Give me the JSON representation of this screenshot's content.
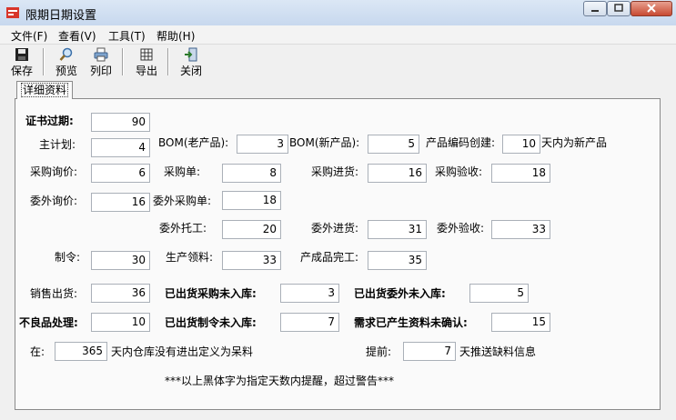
{
  "window": {
    "title": "限期日期设置"
  },
  "menu": [
    "文件(F)",
    "查看(V)",
    "工具(T)",
    "帮助(H)"
  ],
  "toolbar": [
    "保存",
    "预览",
    "列印",
    "导出",
    "关闭"
  ],
  "tab": "详细资料",
  "fields": {
    "cert_expiry": {
      "label": "证书过期:",
      "value": "90"
    },
    "main_plan": {
      "label": "主计划:",
      "value": "4"
    },
    "bom_old": {
      "label": "BOM(老产品):",
      "value": "3"
    },
    "bom_new": {
      "label": "BOM(新产品):",
      "value": "5"
    },
    "code_create": {
      "label": "产品编码创建:",
      "value": "10",
      "suffix": "天内为新产品"
    },
    "purchase_inq": {
      "label": "采购询价:",
      "value": "6"
    },
    "purchase_order": {
      "label": "采购单:",
      "value": "8"
    },
    "purchase_in": {
      "label": "采购进货:",
      "value": "16"
    },
    "purchase_chk": {
      "label": "采购验收:",
      "value": "18"
    },
    "out_inq": {
      "label": "委外询价:",
      "value": "16"
    },
    "out_order": {
      "label": "委外采购单:",
      "value": "18"
    },
    "out_consign": {
      "label": "委外托工:",
      "value": "20"
    },
    "out_in": {
      "label": "委外进货:",
      "value": "31"
    },
    "out_chk": {
      "label": "委外验收:",
      "value": "33"
    },
    "make_order": {
      "label": "制令:",
      "value": "30"
    },
    "prod_pick": {
      "label": "生产领料:",
      "value": "33"
    },
    "finished": {
      "label": "产成品完工:",
      "value": "35"
    },
    "sales_out": {
      "label": "销售出货:",
      "value": "36"
    },
    "shipped_purchase": {
      "label": "已出货采购未入库:",
      "value": "3"
    },
    "shipped_out": {
      "label": "已出货委外未入库:",
      "value": "5"
    },
    "defect": {
      "label": "不良品处理:",
      "value": "10"
    },
    "shipped_make": {
      "label": "已出货制令未入库:",
      "value": "7"
    },
    "demand_unconf": {
      "label": "需求已产生资料未确认:",
      "value": "15"
    },
    "idle_stock": {
      "label": "在:",
      "value": "365",
      "suffix": "天内仓库没有进出定义为呆料"
    },
    "advance": {
      "label": "提前:",
      "value": "7",
      "suffix": "天推送缺料信息"
    }
  },
  "note": "***以上黑体字为指定天数内提醒，超过警告***"
}
